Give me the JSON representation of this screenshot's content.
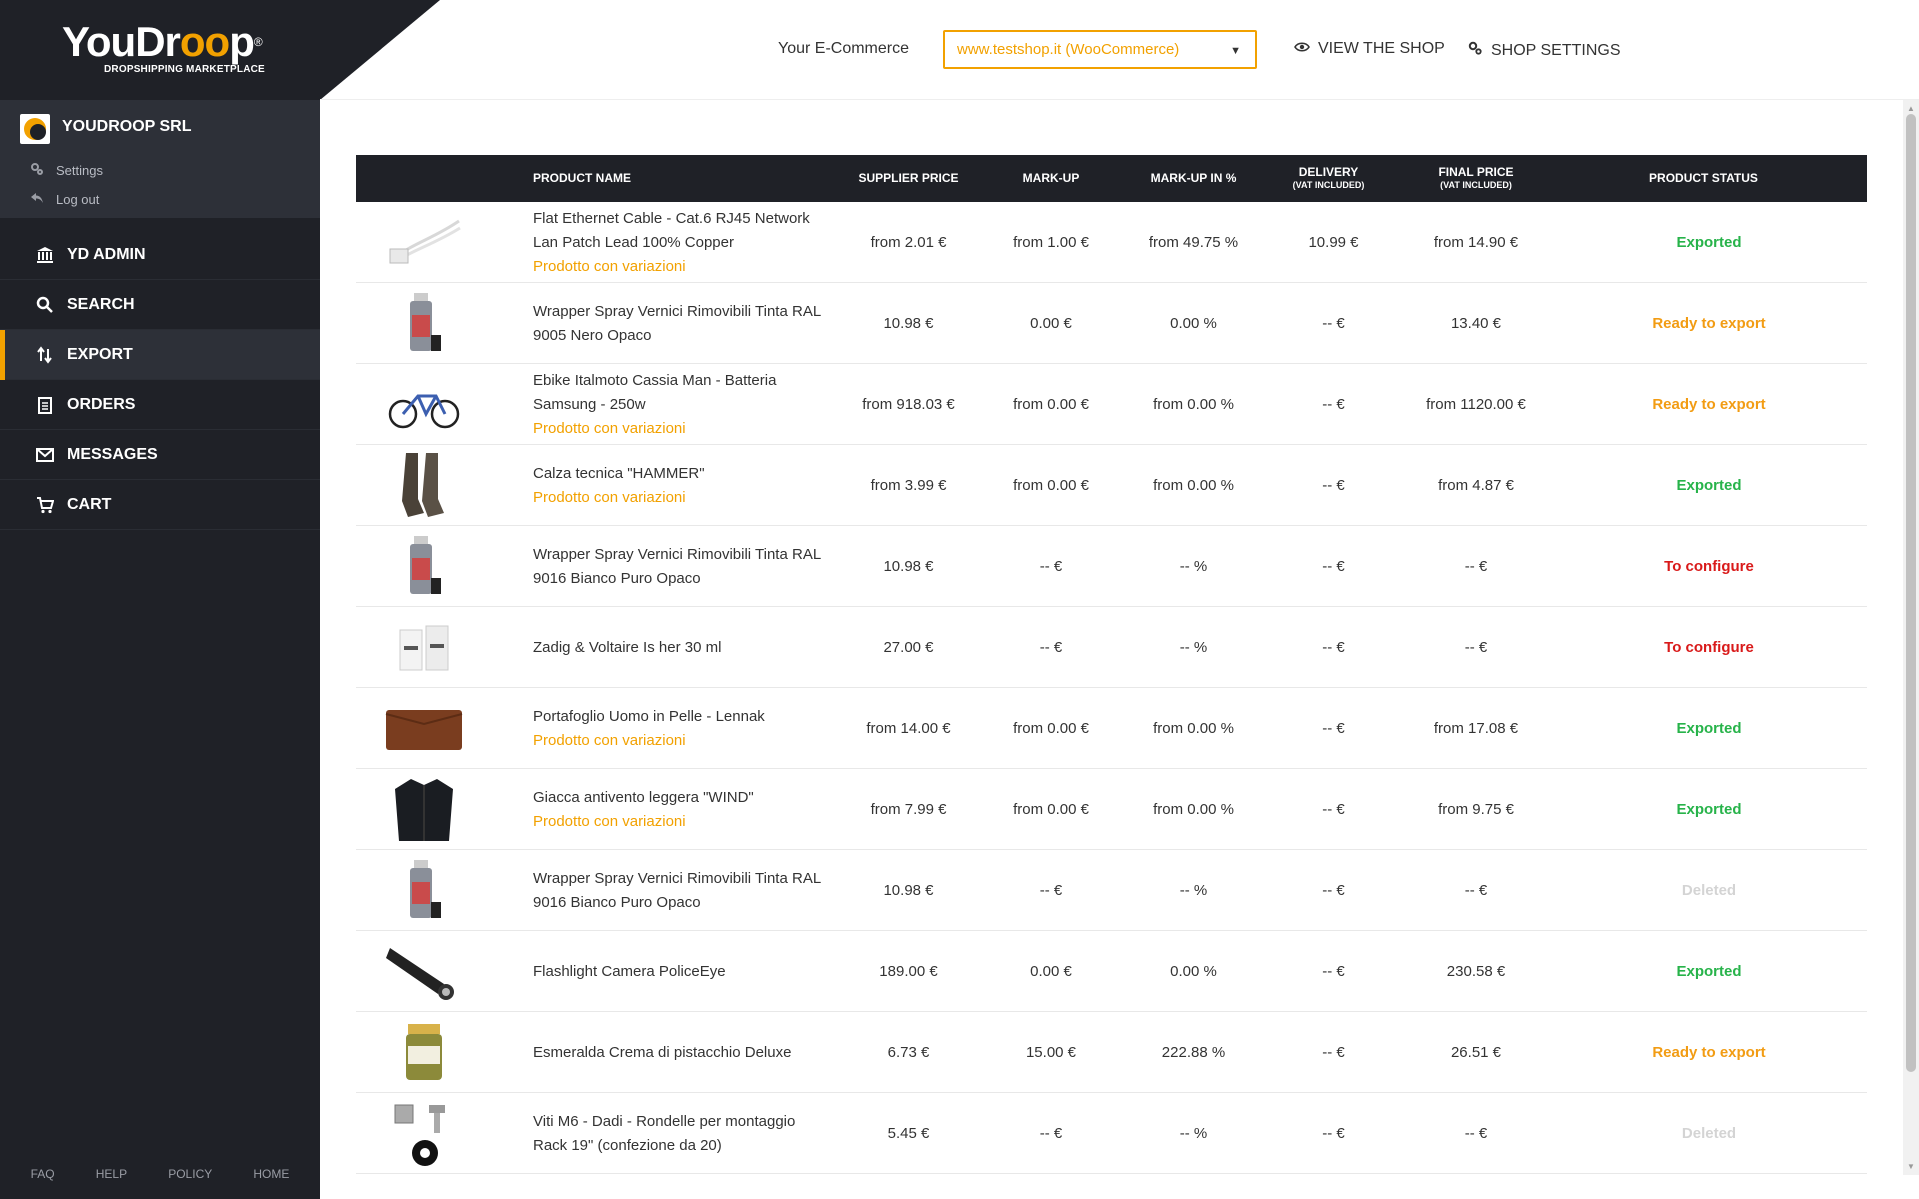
{
  "brand": {
    "logo_prefix": "YouDr",
    "logo_o": "oo",
    "logo_suffix": "p",
    "logo_reg": "®",
    "subtitle": "DROPSHIPPING MARKETPLACE"
  },
  "account": {
    "name": "YOUDROOP SRL",
    "settings_label": "Settings",
    "logout_label": "Log out"
  },
  "nav": [
    {
      "label": "YD ADMIN",
      "icon": "bank-icon"
    },
    {
      "label": "SEARCH",
      "icon": "search-icon"
    },
    {
      "label": "EXPORT",
      "icon": "export-icon",
      "active": true
    },
    {
      "label": "ORDERS",
      "icon": "clipboard-icon"
    },
    {
      "label": "MESSAGES",
      "icon": "envelope-icon"
    },
    {
      "label": "CART",
      "icon": "cart-icon"
    }
  ],
  "footer": {
    "faq": "FAQ",
    "help": "HELP",
    "policy": "POLICY",
    "home": "HOME"
  },
  "topbar": {
    "ecom_label": "Your E-Commerce",
    "shop_value": "www.testshop.it (WooCommerce)",
    "view_shop": "VIEW THE SHOP",
    "shop_settings": "SHOP SETTINGS"
  },
  "table": {
    "headers": {
      "name": "PRODUCT NAME",
      "supplier": "SUPPLIER PRICE",
      "markup": "MARK-UP",
      "markup_pct": "MARK-UP IN %",
      "delivery": "DELIVERY",
      "delivery_sub": "(VAT INCLUDED)",
      "final": "FINAL PRICE",
      "final_sub": "(VAT INCLUDED)",
      "status": "PRODUCT STATUS"
    },
    "rows": [
      {
        "name": "Flat Ethernet Cable - Cat.6 RJ45 Network Lan Patch Lead 100% Copper",
        "variant": "Prodotto con variazioni",
        "supplier": "from 2.01 €",
        "markup": "from 1.00 €",
        "pct": "from 49.75 %",
        "delivery": "10.99 €",
        "final": "from 14.90 €",
        "status": "Exported",
        "status_class": "st-exported",
        "thumb": "cable"
      },
      {
        "name": "Wrapper Spray Vernici Rimovibili Tinta RAL 9005 Nero Opaco",
        "variant": "",
        "supplier": "10.98 €",
        "markup": "0.00 €",
        "pct": "0.00 %",
        "delivery": "-- €",
        "final": "13.40 €",
        "status": "Ready to export",
        "status_class": "st-ready",
        "thumb": "spray"
      },
      {
        "name": "Ebike Italmoto Cassia Man - Batteria Samsung - 250w",
        "variant": "Prodotto con variazioni",
        "supplier": "from 918.03 €",
        "markup": "from 0.00 €",
        "pct": "from 0.00 %",
        "delivery": "-- €",
        "final": "from 1120.00 €",
        "status": "Ready to export",
        "status_class": "st-ready",
        "thumb": "bike"
      },
      {
        "name": "Calza tecnica \"HAMMER\"",
        "variant": "Prodotto con variazioni",
        "supplier": "from 3.99 €",
        "markup": "from 0.00 €",
        "pct": "from 0.00 %",
        "delivery": "-- €",
        "final": "from 4.87 €",
        "status": "Exported",
        "status_class": "st-exported",
        "thumb": "socks"
      },
      {
        "name": "Wrapper Spray Vernici Rimovibili Tinta RAL 9016 Bianco Puro Opaco",
        "variant": "",
        "supplier": "10.98 €",
        "markup": "-- €",
        "pct": "-- %",
        "delivery": "-- €",
        "final": "-- €",
        "status": "To configure",
        "status_class": "st-config",
        "thumb": "spray"
      },
      {
        "name": "Zadig & Voltaire Is her 30 ml",
        "variant": "",
        "supplier": "27.00 €",
        "markup": "-- €",
        "pct": "-- %",
        "delivery": "-- €",
        "final": "-- €",
        "status": "To configure",
        "status_class": "st-config",
        "thumb": "perfume"
      },
      {
        "name": "Portafoglio Uomo in Pelle - Lennak",
        "variant": "Prodotto con variazioni",
        "supplier": "from 14.00 €",
        "markup": "from 0.00 €",
        "pct": "from 0.00 %",
        "delivery": "-- €",
        "final": "from 17.08 €",
        "status": "Exported",
        "status_class": "st-exported",
        "thumb": "wallet"
      },
      {
        "name": "Giacca antivento leggera \"WIND\"",
        "variant": "Prodotto con variazioni",
        "supplier": "from 7.99 €",
        "markup": "from 0.00 €",
        "pct": "from 0.00 %",
        "delivery": "-- €",
        "final": "from 9.75 €",
        "status": "Exported",
        "status_class": "st-exported",
        "thumb": "jacket"
      },
      {
        "name": "Wrapper Spray Vernici Rimovibili Tinta RAL 9016 Bianco Puro Opaco",
        "variant": "",
        "supplier": "10.98 €",
        "markup": "-- €",
        "pct": "-- %",
        "delivery": "-- €",
        "final": "-- €",
        "status": "Deleted",
        "status_class": "st-deleted",
        "thumb": "spray"
      },
      {
        "name": "Flashlight Camera PoliceEye",
        "variant": "",
        "supplier": "189.00 €",
        "markup": "0.00 €",
        "pct": "0.00 %",
        "delivery": "-- €",
        "final": "230.58 €",
        "status": "Exported",
        "status_class": "st-exported",
        "thumb": "flashlight"
      },
      {
        "name": "Esmeralda Crema di pistacchio Deluxe",
        "variant": "",
        "supplier": "6.73 €",
        "markup": "15.00 €",
        "pct": "222.88 %",
        "delivery": "-- €",
        "final": "26.51 €",
        "status": "Ready to export",
        "status_class": "st-ready",
        "thumb": "jar"
      },
      {
        "name": "Viti M6 - Dadi - Rondelle per montaggio Rack 19\" (confezione da 20)",
        "variant": "",
        "supplier": "5.45 €",
        "markup": "-- €",
        "pct": "-- %",
        "delivery": "-- €",
        "final": "-- €",
        "status": "Deleted",
        "status_class": "st-deleted",
        "thumb": "screws"
      }
    ]
  },
  "colors": {
    "accent": "#f2a100",
    "sidebar": "#1f2127",
    "exported": "#27b34a",
    "ready": "#f29c13",
    "configure": "#d91a1a",
    "deleted": "#d4d4d4"
  }
}
